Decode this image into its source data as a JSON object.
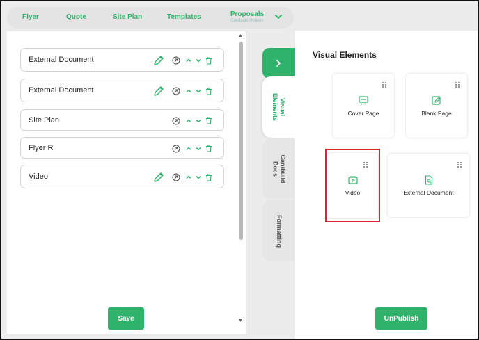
{
  "nav": {
    "items": [
      "Flyer",
      "Quote",
      "Site Plan",
      "Templates"
    ],
    "proposals_label": "Proposals",
    "proposals_sub": "Canibuild Houses"
  },
  "documents": [
    {
      "label": "External Document",
      "has_edit": true
    },
    {
      "label": "External Document",
      "has_edit": true
    },
    {
      "label": "Site Plan",
      "has_edit": false
    },
    {
      "label": "Flyer R",
      "has_edit": false
    },
    {
      "label": "Video",
      "has_edit": true
    }
  ],
  "left": {
    "save_label": "Save"
  },
  "tabs": {
    "visual_line1": "Visual",
    "visual_line2": "Elements",
    "docs_line1": "Canibuild",
    "docs_line2": "Docs",
    "formatting": "Formatting"
  },
  "right": {
    "title": "Visual Elements",
    "cards": [
      "Cover Page",
      "Blank Page",
      "Video",
      "External Document"
    ],
    "unpublish_label": "UnPublish"
  },
  "colors": {
    "accent": "#2fb36b",
    "highlight": "#d9262b"
  },
  "icons": [
    "pencil-icon",
    "move-icon",
    "chevron-up-icon",
    "chevron-down-icon",
    "trash-icon",
    "chevron-right-icon",
    "grip-icon",
    "cover-page-icon",
    "blank-page-icon",
    "video-icon",
    "external-document-icon"
  ]
}
